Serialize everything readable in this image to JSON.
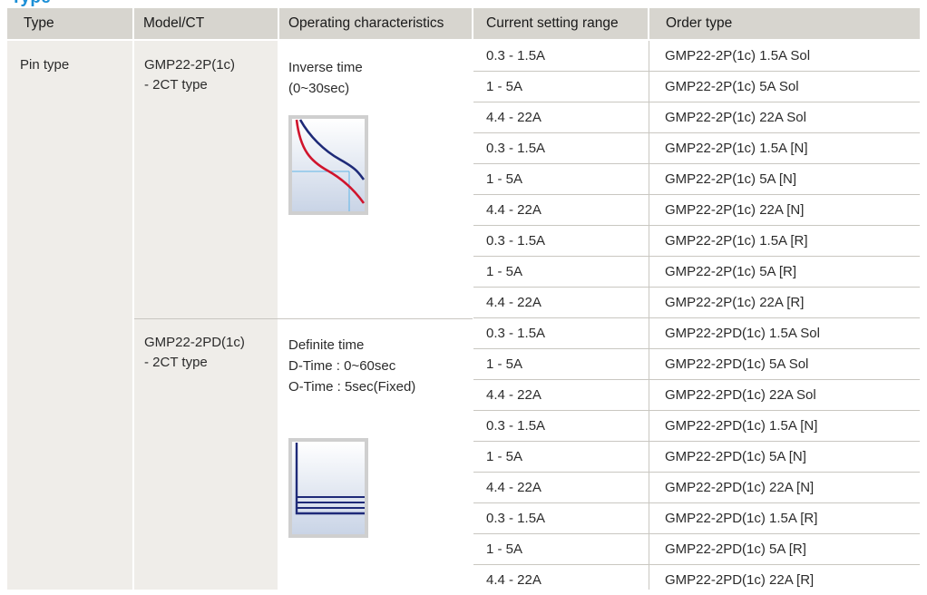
{
  "section_title": "Type",
  "header": {
    "type": "Type",
    "model": "Model/CT",
    "characteristics": "Operating characteristics",
    "range": "Current setting range",
    "order": "Order type"
  },
  "type_value": "Pin type",
  "groups": [
    {
      "model_line1": "GMP22-2P(1c)",
      "model_line2": "- 2CT type",
      "char_line1": "Inverse time",
      "char_line2": "(0~30sec)",
      "char_line3": "",
      "curve_icon": "inverse-time-curve-icon",
      "rows": [
        {
          "range": "0.3 - 1.5A",
          "order": "GMP22-2P(1c)  1.5A Sol"
        },
        {
          "range": "1 - 5A",
          "order": "GMP22-2P(1c)  5A Sol"
        },
        {
          "range": "4.4 - 22A",
          "order": "GMP22-2P(1c)  22A Sol"
        },
        {
          "range": "0.3 - 1.5A",
          "order": "GMP22-2P(1c)  1.5A [N]"
        },
        {
          "range": "1 - 5A",
          "order": "GMP22-2P(1c)  5A [N]"
        },
        {
          "range": "4.4 - 22A",
          "order": "GMP22-2P(1c)  22A [N]"
        },
        {
          "range": "0.3 - 1.5A",
          "order": "GMP22-2P(1c)  1.5A [R]"
        },
        {
          "range": "1 - 5A",
          "order": "GMP22-2P(1c)  5A [R]"
        },
        {
          "range": "4.4 - 22A",
          "order": "GMP22-2P(1c)  22A [R]"
        }
      ]
    },
    {
      "model_line1": "GMP22-2PD(1c)",
      "model_line2": "- 2CT type",
      "char_line1": "Definite time",
      "char_line2": "D-Time : 0~60sec",
      "char_line3": "O-Time : 5sec(Fixed)",
      "curve_icon": "definite-time-curve-icon",
      "rows": [
        {
          "range": "0.3 - 1.5A",
          "order": "GMP22-2PD(1c)  1.5A Sol"
        },
        {
          "range": "1 - 5A",
          "order": "GMP22-2PD(1c)  5A Sol"
        },
        {
          "range": "4.4 - 22A",
          "order": "GMP22-2PD(1c)  22A Sol"
        },
        {
          "range": "0.3 - 1.5A",
          "order": "GMP22-2PD(1c)  1.5A [N]"
        },
        {
          "range": "1 - 5A",
          "order": "GMP22-2PD(1c)  5A [N]"
        },
        {
          "range": "4.4 - 22A",
          "order": "GMP22-2PD(1c)  22A [N]"
        },
        {
          "range": "0.3 - 1.5A",
          "order": "GMP22-2PD(1c)  1.5A [R]"
        },
        {
          "range": "1 - 5A",
          "order": "GMP22-2PD(1c)  5A [R]"
        },
        {
          "range": "4.4 - 22A",
          "order": "GMP22-2PD(1c)  22A [R]"
        }
      ]
    }
  ],
  "colors": {
    "title_blue": "#1b8fd6",
    "header_gray": "#d7d5cf",
    "side_column_bg": "#efede9",
    "curve_red": "#d0142c",
    "curve_navy": "#1e2a78",
    "curve_grid_blue": "#5fb6e8"
  }
}
